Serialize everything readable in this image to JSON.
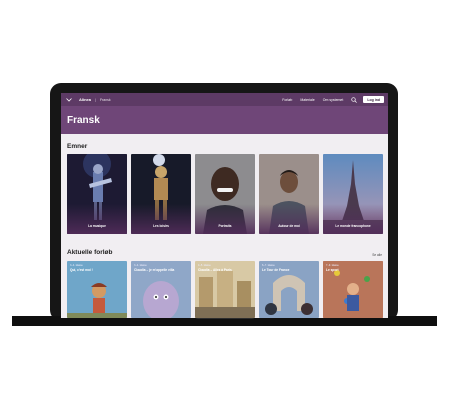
{
  "nav": {
    "brand": "Alinea",
    "separator": "|",
    "crumb": "Fransk",
    "links": [
      "Forløb",
      "Materiale",
      "Om systemet"
    ],
    "login_label": "Log ind"
  },
  "hero": {
    "title": "Fransk"
  },
  "topics": {
    "heading": "Emner",
    "items": [
      {
        "label": "La musique"
      },
      {
        "label": "Les loisirs"
      },
      {
        "label": "Portraits"
      },
      {
        "label": "Autour de moi"
      },
      {
        "label": "Le monde francophone"
      }
    ]
  },
  "courses": {
    "heading": "Aktuelle forløb",
    "see_all": "Se alle",
    "items": [
      {
        "meta": "3.-4. klasse",
        "title": "Qui, c'est moi !"
      },
      {
        "meta": "3.-4. klasse",
        "title": "Claudia – je m'appelle villa"
      },
      {
        "meta": "4.-5. klasse",
        "title": "Claudia – Allez à Paris"
      },
      {
        "meta": "6.-7. klasse",
        "title": "Le Tour de France"
      },
      {
        "meta": "7.-9. klasse",
        "title": "Le sport"
      }
    ]
  },
  "colors": {
    "nav": "#5d3a65",
    "hero": "#6f4678",
    "accent": "#6b3f74"
  },
  "icons": {
    "menu": "chevron-down-icon",
    "search": "search-icon"
  }
}
